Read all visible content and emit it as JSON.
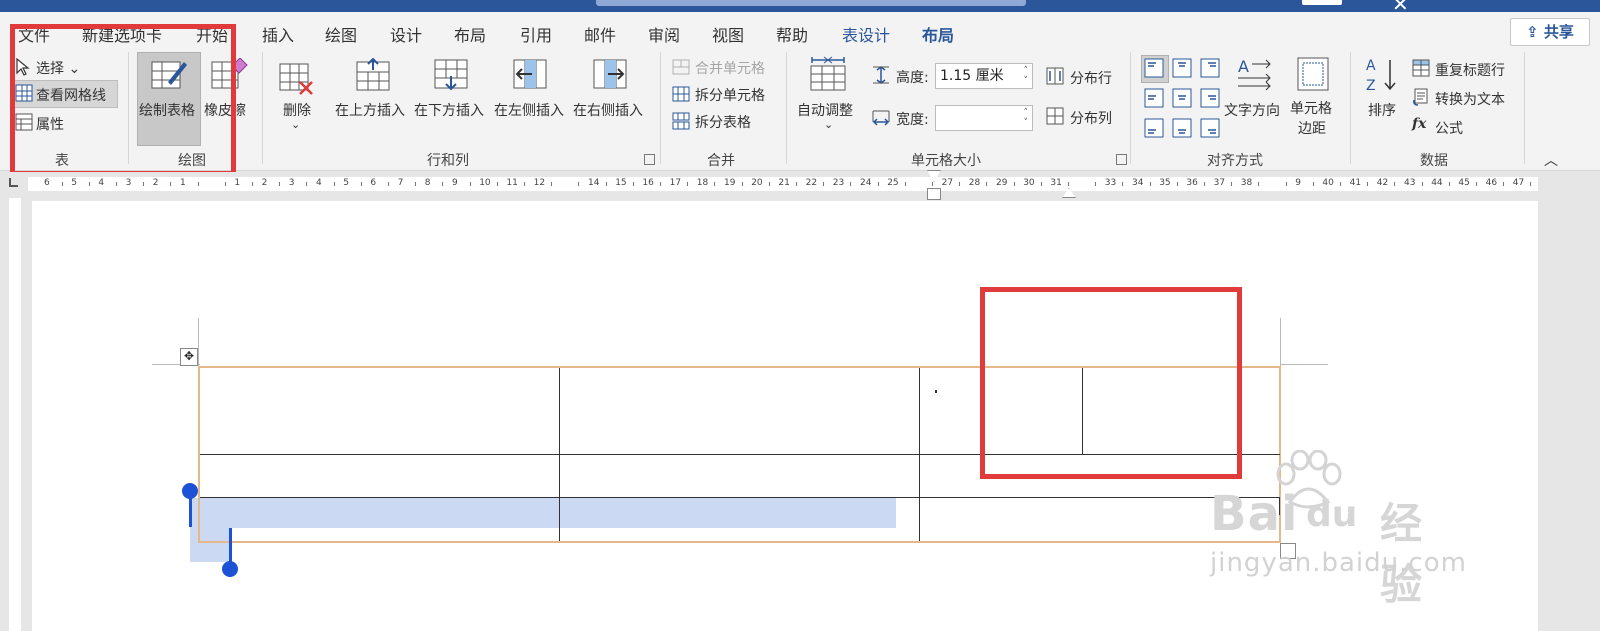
{
  "tabs": [
    {
      "label": "文件"
    },
    {
      "label": "新建选项卡"
    },
    {
      "label": "开始"
    },
    {
      "label": "插入"
    },
    {
      "label": "绘图"
    },
    {
      "label": "设计"
    },
    {
      "label": "布局"
    },
    {
      "label": "引用"
    },
    {
      "label": "邮件"
    },
    {
      "label": "审阅"
    },
    {
      "label": "视图"
    },
    {
      "label": "帮助"
    },
    {
      "label": "表设计"
    },
    {
      "label": "布局"
    }
  ],
  "share_label": "共享",
  "ribbon": {
    "table_group": {
      "select": "选择",
      "view_gridlines": "查看网格线",
      "properties": "属性",
      "label": "表"
    },
    "draw_group": {
      "draw_table": "绘制表格",
      "eraser": "橡皮擦",
      "label": "绘图"
    },
    "rows_cols_group": {
      "delete": "删除",
      "insert_above": "在上方插入",
      "insert_below": "在下方插入",
      "insert_left": "在左侧插入",
      "insert_right": "在右侧插入",
      "label": "行和列"
    },
    "merge_group": {
      "merge_cells": "合并单元格",
      "split_cells": "拆分单元格",
      "split_table": "拆分表格",
      "label": "合并"
    },
    "cell_size_group": {
      "autofit": "自动调整",
      "height_label": "高度:",
      "height_value": "1.15 厘米",
      "width_label": "宽度:",
      "width_value": "",
      "distribute_rows": "分布行",
      "distribute_cols": "分布列",
      "label": "单元格大小"
    },
    "alignment_group": {
      "text_direction": "文字方向",
      "cell_margins_1": "单元格",
      "cell_margins_2": "边距",
      "label": "对齐方式"
    },
    "data_group": {
      "sort": "排序",
      "repeat_header": "重复标题行",
      "convert_text": "转换为文本",
      "formula": "公式",
      "formula_icon": "fx",
      "label": "数据"
    }
  },
  "ruler_numbers": [
    "6",
    "5",
    "4",
    "3",
    "2",
    "1",
    "",
    "1",
    "2",
    "3",
    "4",
    "5",
    "6",
    "7",
    "8",
    "9",
    "10",
    "11",
    "12",
    "",
    "14",
    "15",
    "16",
    "17",
    "18",
    "19",
    "20",
    "21",
    "22",
    "23",
    "24",
    "25",
    "",
    "27",
    "28",
    "29",
    "30",
    "31",
    "",
    "33",
    "34",
    "35",
    "36",
    "37",
    "38",
    "",
    "9",
    "40",
    "41",
    "42",
    "43",
    "44",
    "45",
    "46",
    "47"
  ],
  "watermark": {
    "brand": "Bai",
    "brand2": "du",
    "cn": "经验",
    "url": "jingyan.baidu.com"
  },
  "colors": {
    "accent": "#2b579a",
    "highlight": "#e03a3a",
    "selection": "#cbd9f2",
    "handle": "#1d52d6"
  }
}
